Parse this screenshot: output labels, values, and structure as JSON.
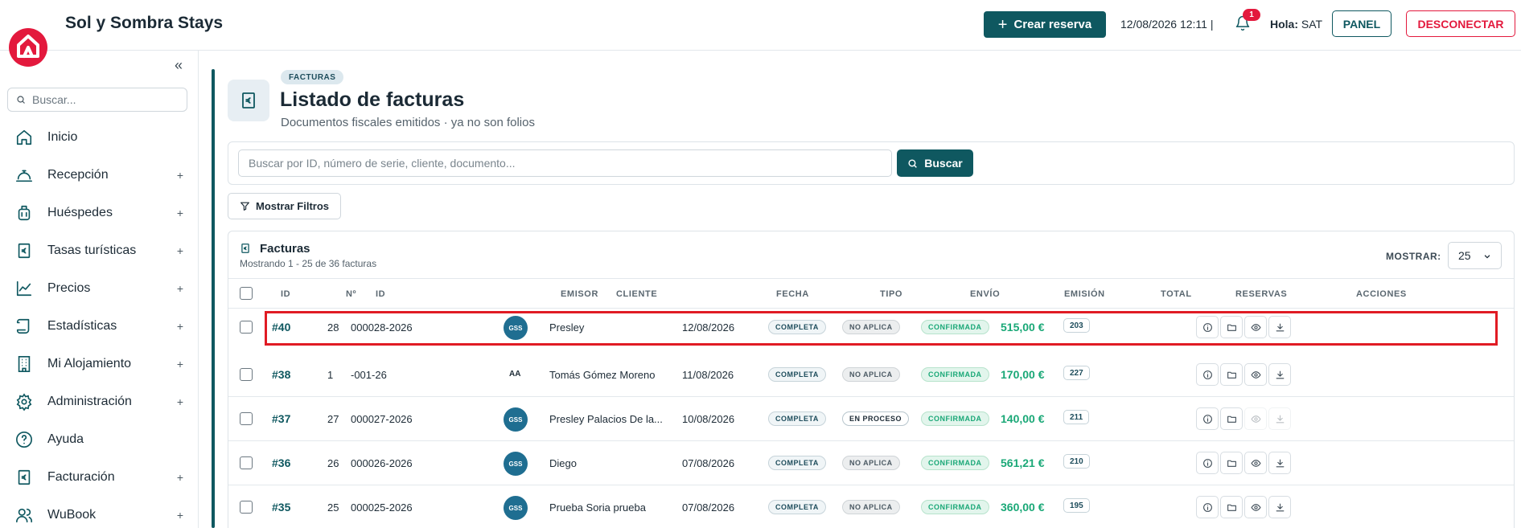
{
  "app": {
    "title": "Sol y Sombra Stays"
  },
  "topbar": {
    "create_label": "Crear reserva",
    "datetime": "12/08/2026 12:11 |",
    "notifications_count": "1",
    "greeting": "Hola:",
    "user": "SAT",
    "panel_label": "PANEL",
    "logout_label": "DESCONECTAR"
  },
  "sidebar": {
    "search_placeholder": "Buscar...",
    "items": [
      {
        "label": "Inicio",
        "icon": "home-icon",
        "expandable": false
      },
      {
        "label": "Recepción",
        "icon": "reception-bell-icon",
        "expandable": true
      },
      {
        "label": "Huéspedes",
        "icon": "luggage-icon",
        "expandable": true
      },
      {
        "label": "Tasas turísticas",
        "icon": "euro-receipt-icon",
        "expandable": true
      },
      {
        "label": "Precios",
        "icon": "chart-line-icon",
        "expandable": true
      },
      {
        "label": "Estadísticas",
        "icon": "scroll-icon",
        "expandable": true
      },
      {
        "label": "Mi Alojamiento",
        "icon": "building-icon",
        "expandable": true
      },
      {
        "label": "Administración",
        "icon": "gear-icon",
        "expandable": true
      },
      {
        "label": "Ayuda",
        "icon": "help-icon",
        "expandable": false
      },
      {
        "label": "Facturación",
        "icon": "euro-receipt-icon",
        "expandable": true
      },
      {
        "label": "WuBook",
        "icon": "user-group-icon",
        "expandable": true
      }
    ]
  },
  "header": {
    "tag": "FACTURAS",
    "title": "Listado de facturas",
    "subtitle": "Documentos fiscales emitidos · ya no son folios"
  },
  "search": {
    "placeholder": "Buscar por ID, número de serie, cliente, documento...",
    "button_label": "Buscar"
  },
  "filters": {
    "button_label": "Mostrar Filtros"
  },
  "table": {
    "title": "Facturas",
    "subtitle": "Mostrando 1 - 25 de 36 facturas",
    "show_label": "MOSTRAR:",
    "page_size": "25",
    "columns": [
      "ID",
      "Nº",
      "ID",
      "EMISOR",
      "CLIENTE",
      "FECHA",
      "TIPO",
      "ENVÍO",
      "EMISIÓN",
      "TOTAL",
      "RESERVAS",
      "ACCIONES"
    ],
    "rows": [
      {
        "id": "#40",
        "num": "28",
        "serie": "000028-2026",
        "emisor": "GSS",
        "emisor_style": "badge",
        "cliente": "Presley",
        "fecha": "12/08/2026",
        "tipo": "COMPLETA",
        "envio": "NO APLICA",
        "envio_style": "na",
        "emision": "CONFIRMADA",
        "total": "515,00 €",
        "reservas": "203",
        "highlighted": true,
        "view_enabled": true,
        "download_enabled": true
      },
      {
        "id": "#38",
        "num": "1",
        "serie": "-001-26",
        "emisor": "AA",
        "emisor_style": "text",
        "cliente": "Tomás Gómez Moreno",
        "fecha": "11/08/2026",
        "tipo": "COMPLETA",
        "envio": "NO APLICA",
        "envio_style": "na",
        "emision": "CONFIRMADA",
        "total": "170,00 €",
        "reservas": "227",
        "highlighted": false,
        "view_enabled": true,
        "download_enabled": true
      },
      {
        "id": "#37",
        "num": "27",
        "serie": "000027-2026",
        "emisor": "GSS",
        "emisor_style": "badge",
        "cliente": "Presley Palacios De la...",
        "fecha": "10/08/2026",
        "tipo": "COMPLETA",
        "envio": "EN PROCESO",
        "envio_style": "proc",
        "emision": "CONFIRMADA",
        "total": "140,00 €",
        "reservas": "211",
        "highlighted": false,
        "view_enabled": false,
        "download_enabled": false
      },
      {
        "id": "#36",
        "num": "26",
        "serie": "000026-2026",
        "emisor": "GSS",
        "emisor_style": "badge",
        "cliente": "Diego",
        "fecha": "07/08/2026",
        "tipo": "COMPLETA",
        "envio": "NO APLICA",
        "envio_style": "na",
        "emision": "CONFIRMADA",
        "total": "561,21 €",
        "reservas": "210",
        "highlighted": false,
        "view_enabled": true,
        "download_enabled": true
      },
      {
        "id": "#35",
        "num": "25",
        "serie": "000025-2026",
        "emisor": "GSS",
        "emisor_style": "badge",
        "cliente": "Prueba Soria prueba",
        "fecha": "07/08/2026",
        "tipo": "COMPLETA",
        "envio": "NO APLICA",
        "envio_style": "na",
        "emision": "CONFIRMADA",
        "total": "360,00 €",
        "reservas": "195",
        "highlighted": false,
        "view_enabled": true,
        "download_enabled": true
      }
    ]
  },
  "colors": {
    "brand_red": "#e3193d",
    "primary_teal": "#0f5860",
    "success_green": "#1aa877",
    "emisor_blue": "#1f6e91",
    "highlight_red": "#e01b24"
  }
}
